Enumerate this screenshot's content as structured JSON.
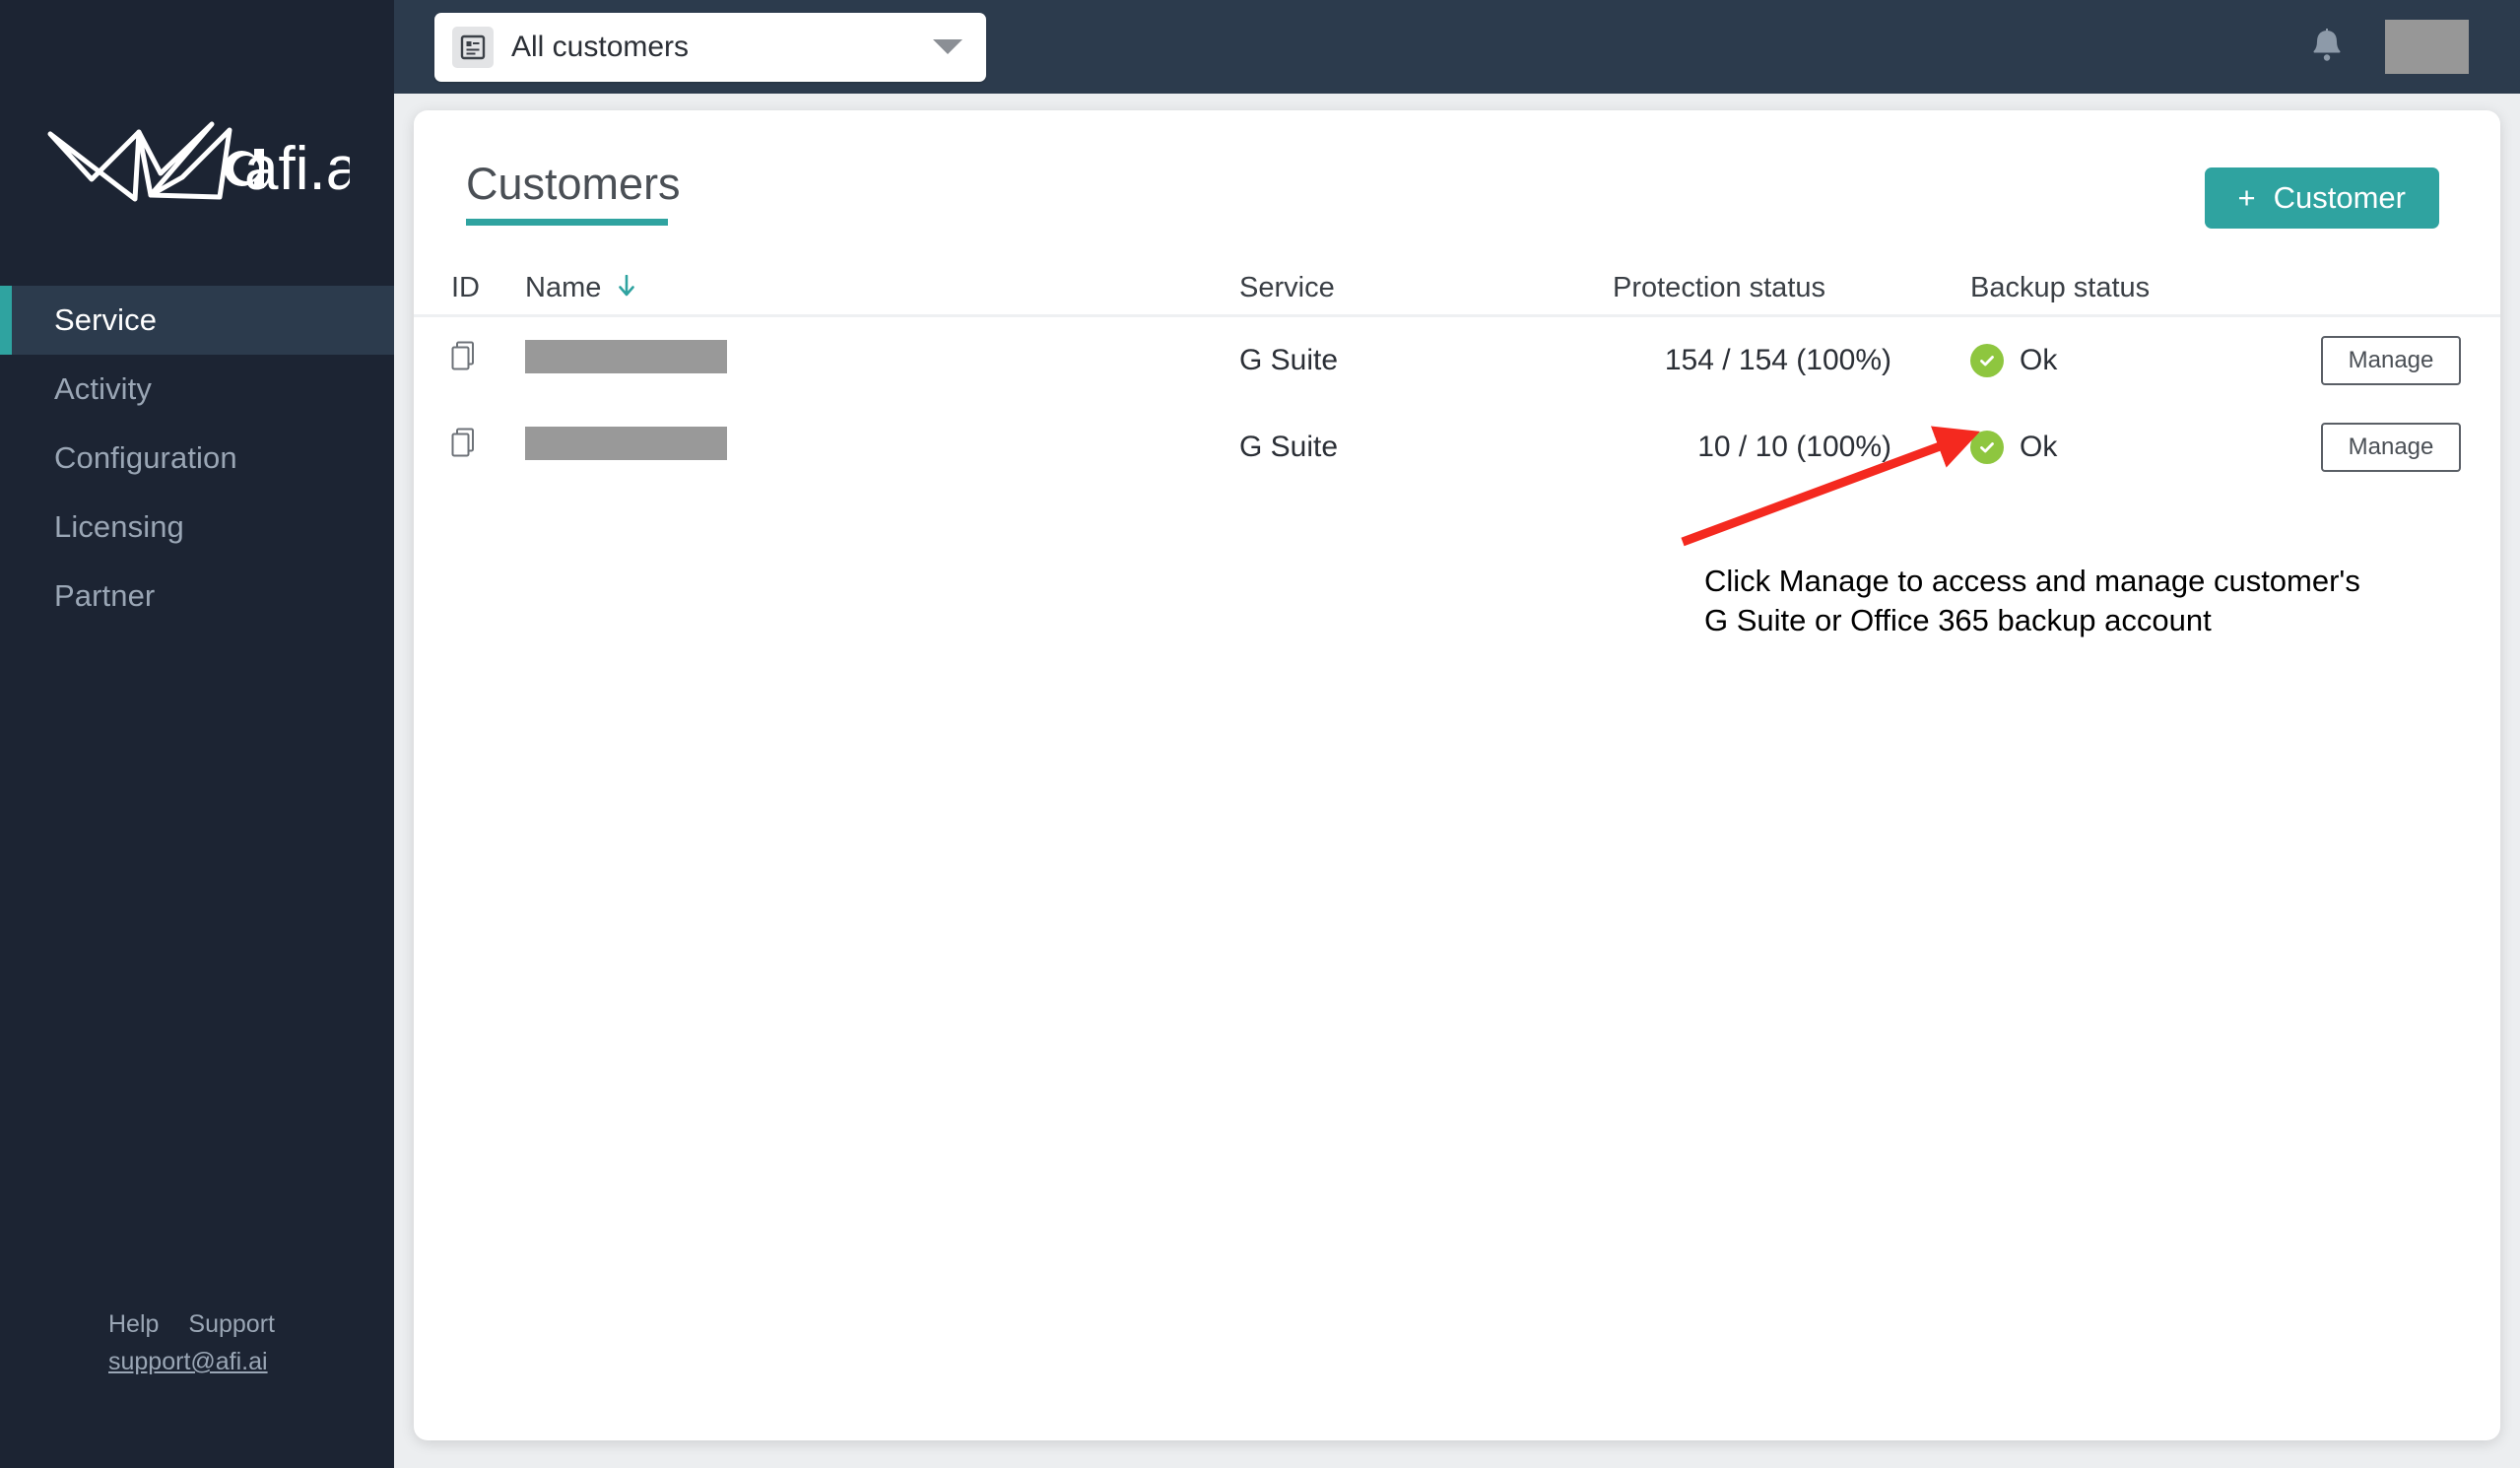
{
  "brand": {
    "logo_text": "afi.ai",
    "accent_color": "#2fa3a0",
    "sidebar_color": "#1c2433",
    "topbar_color": "#2c3b4d",
    "ok_color": "#8ec63f",
    "annotation_color": "#f4291f"
  },
  "sidebar": {
    "items": [
      {
        "label": "Service",
        "active": true
      },
      {
        "label": "Activity",
        "active": false
      },
      {
        "label": "Configuration",
        "active": false
      },
      {
        "label": "Licensing",
        "active": false
      },
      {
        "label": "Partner",
        "active": false
      }
    ],
    "footer": {
      "help_label": "Help",
      "support_label": "Support",
      "email": "support@afi.ai"
    }
  },
  "topbar": {
    "customer_select": {
      "value": "All customers",
      "icon": "list-document-icon",
      "caret": "chevron-down-icon"
    },
    "notifications_icon": "bell-icon",
    "user_avatar": "user-avatar-redacted"
  },
  "main": {
    "title": "Customers",
    "add_button": {
      "plus": "+",
      "label": "Customer"
    },
    "table": {
      "columns": [
        "ID",
        "Name",
        "Service",
        "Protection status",
        "Backup status",
        ""
      ],
      "sort": {
        "column": "Name",
        "direction": "desc",
        "icon": "arrow-down-icon"
      },
      "rows": [
        {
          "id_icon": "copy-icon",
          "name": "",
          "name_redacted": true,
          "service": "G Suite",
          "protection_status": "154 / 154 (100%)",
          "backup_status": "Ok",
          "backup_status_icon": "check-circle-icon",
          "action_label": "Manage"
        },
        {
          "id_icon": "copy-icon",
          "name": "",
          "name_redacted": true,
          "service": "G Suite",
          "protection_status": "10 / 10 (100%)",
          "backup_status": "Ok",
          "backup_status_icon": "check-circle-icon",
          "action_label": "Manage"
        }
      ]
    },
    "annotation": {
      "text": "Click Manage to access and manage customer's\nG Suite or Office 365 backup account",
      "arrow": "red-arrow-pointing-up-right"
    }
  }
}
